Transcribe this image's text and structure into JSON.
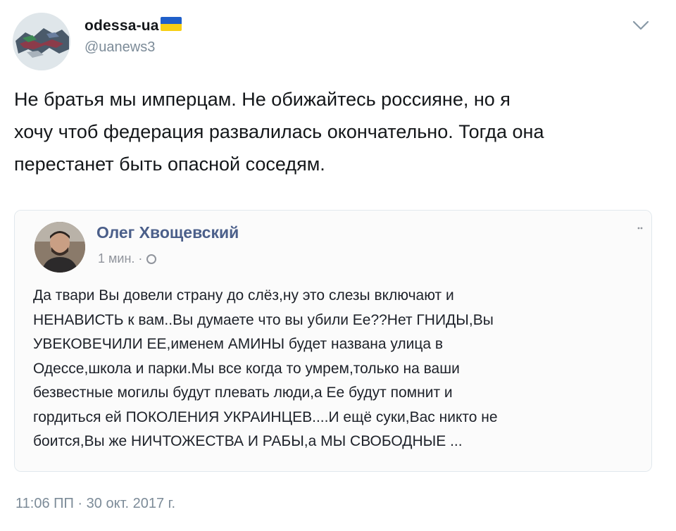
{
  "tweet": {
    "display_name": "odessa-ua",
    "flag_icon": "ukraine-flag-icon",
    "flag_colors": [
      "#1f5fc9",
      "#f7cf14"
    ],
    "handle": "@uanews3",
    "menu_icon": "chevron-down-icon",
    "text_lines": [
      "Не братья мы имперцам. Не обижайтесь россияне, но я",
      "хочу чтоб федерация развалилась окончательно. Тогда она",
      "перестанет быть опасной соседям."
    ],
    "timestamp": "11:06 ПП · 30 окт. 2017 г."
  },
  "embedded_post": {
    "author": "Олег Хвощевский",
    "time": "1 мин. ·",
    "privacy_icon": "globe-icon",
    "more_icon": "ellipsis-icon",
    "text_lines": [
      "Да твари Вы довели страну до слёз,ну это слезы включают и",
      "НЕНАВИСТЬ к вам..Вы думаете что вы убили Ее??Нет ГНИДЫ,Вы",
      "УВЕКОВЕЧИЛИ ЕЕ,именем АМИНЫ будет названа улица в",
      "Одессе,школа и парки.Мы все когда то умрем,только на ваши",
      "безвестные могилы будут плевать люди,а Ее будут помнит и",
      "гордиться ей ПОКОЛЕНИЯ УКРАИНЦЕВ....И ещё суки,Вас никто не",
      "боится,Вы же НИЧТОЖЕСТВА И РАБЫ,а МЫ СВОБОДНЫЕ ..."
    ]
  },
  "colors": {
    "name": "#14171a",
    "secondary": "#7c8b98",
    "fb_name": "#4b5f8a",
    "border": "#e1e8ed"
  }
}
